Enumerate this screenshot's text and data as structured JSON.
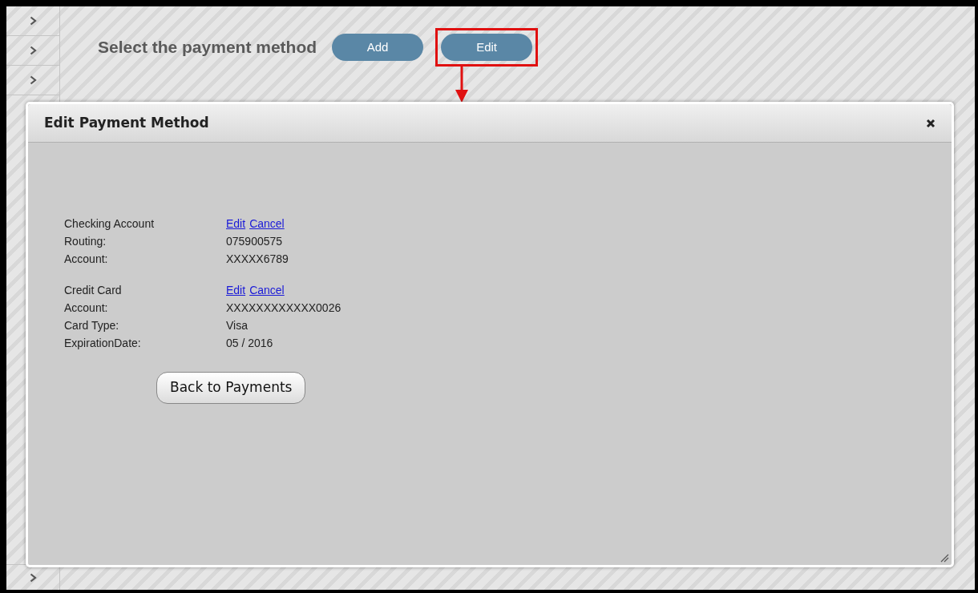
{
  "header": {
    "title": "Select the payment method",
    "buttons": [
      {
        "label": "Add",
        "highlighted": false
      },
      {
        "label": "Edit",
        "highlighted": true
      }
    ]
  },
  "dialog": {
    "title": "Edit Payment Method",
    "sections": [
      {
        "heading": "Checking Account",
        "links": [
          "Edit",
          "Cancel"
        ],
        "fields": [
          {
            "label": "Routing:",
            "value": "075900575"
          },
          {
            "label": "Account:",
            "value": "XXXXX6789"
          }
        ]
      },
      {
        "heading": "Credit Card",
        "links": [
          "Edit",
          "Cancel"
        ],
        "fields": [
          {
            "label": "Account:",
            "value": "XXXXXXXXXXXX0026"
          },
          {
            "label": "Card Type:",
            "value": "Visa"
          },
          {
            "label": "ExpirationDate:",
            "value": "05 / 2016"
          }
        ]
      }
    ],
    "button": "Back to Payments"
  }
}
